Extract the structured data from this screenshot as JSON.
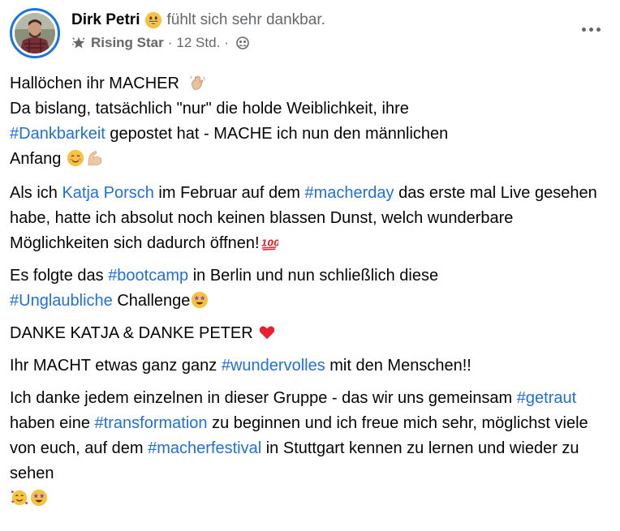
{
  "post": {
    "author": "Dirk Petri",
    "feeling": "fühlt sich sehr dankbar.",
    "badge": "Rising Star",
    "time": "12 Std.",
    "separator": "·",
    "icons": {
      "avatar": "profile-photo",
      "feeling": "grinning-face-emoji",
      "badge": "star-badge-icon",
      "audience": "group-audience-icon",
      "more": "more-options-icon"
    },
    "colors": {
      "link": "#216fdb",
      "secondary_text": "#65676b",
      "avatar_ring": "#1b74e4"
    }
  },
  "content": {
    "p1": {
      "l1": "Hallöchen ihr MACHER",
      "l2a": "Da bislang, tatsächlich \"nur\" die holde Weiblichkeit,  ihre",
      "hashtag1": "#Dankbarkeit",
      "l3b": " gepostet hat - MACHE ich nun den männlichen",
      "l4": "Anfang"
    },
    "p2": {
      "a": "Als ich ",
      "mention": "Katja Porsch",
      "b": " im Februar auf dem ",
      "hashtag": "#macherday",
      "c": " das erste mal Live gesehen habe, hatte ich absolut noch keinen blassen Dunst, welch wunderbare Möglichkeiten sich dadurch öffnen!"
    },
    "p3": {
      "a": "Es folgte das ",
      "hashtag1": "#bootcamp",
      "b": " in Berlin und nun schließlich diese ",
      "hashtag2": "#Unglaubliche",
      "c": " Challenge"
    },
    "p4": {
      "text": "DANKE KATJA & DANKE PETER "
    },
    "p5": {
      "a": "Ihr MACHT etwas ganz ganz ",
      "hashtag": "#wundervolles",
      "b": " mit den Menschen!!"
    },
    "p6": {
      "a": "Ich danke jedem einzelnen in dieser Gruppe - das wir uns gemeinsam ",
      "hashtag1": "#getraut",
      "b": " haben eine ",
      "hashtag2": "#transformation",
      "c": " zu beginnen und ich freue mich sehr, möglichst viele von euch, auf dem ",
      "hashtag3": "#macherfestival",
      "d": " in Stuttgart kennen zu lernen und wieder zu sehen"
    },
    "emojis": [
      "waving-hand",
      "smiling-face",
      "flexed-biceps",
      "hundred-points",
      "star-struck",
      "red-heart",
      "smiling-face-with-hearts",
      "star-struck"
    ]
  }
}
